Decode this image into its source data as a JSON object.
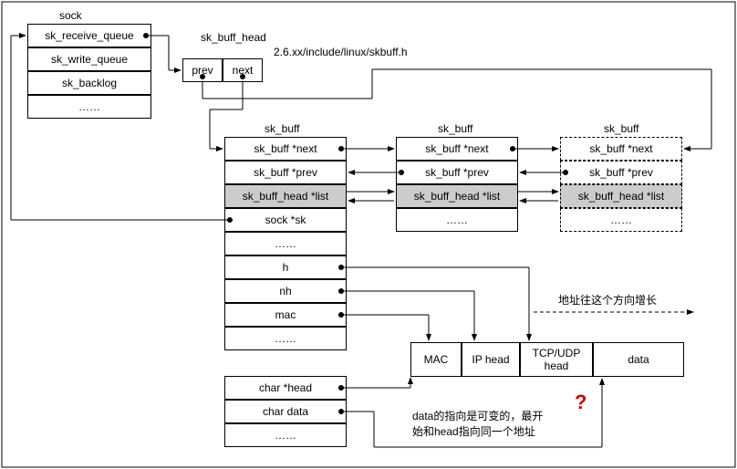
{
  "labels": {
    "sock": "sock",
    "sk_buff_head": "sk_buff_head",
    "path": "2.6.xx/include/linux/skbuff.h",
    "sk_buff": "sk_buff",
    "addr_grow": "地址往这个方向增长",
    "data_note": "data的指向是可变的，最开\n始和head指向同一个地址"
  },
  "sock_fields": [
    "sk_receive_queue",
    "sk_write_queue",
    "sk_backlog",
    "……"
  ],
  "head_fields": [
    "prev",
    "next"
  ],
  "skbuff_main": [
    "sk_buff *next",
    "sk_buff *prev",
    "sk_buff_head *list",
    "sock *sk",
    "……",
    "h",
    "nh",
    "mac",
    "……",
    "char *head",
    "char data",
    "……"
  ],
  "skbuff_side": [
    "sk_buff *next",
    "sk_buff *prev",
    "sk_buff_head *list",
    "……"
  ],
  "packet": [
    "MAC",
    "IP head",
    "TCP/UDP\nhead",
    "data"
  ],
  "qmark": "?"
}
